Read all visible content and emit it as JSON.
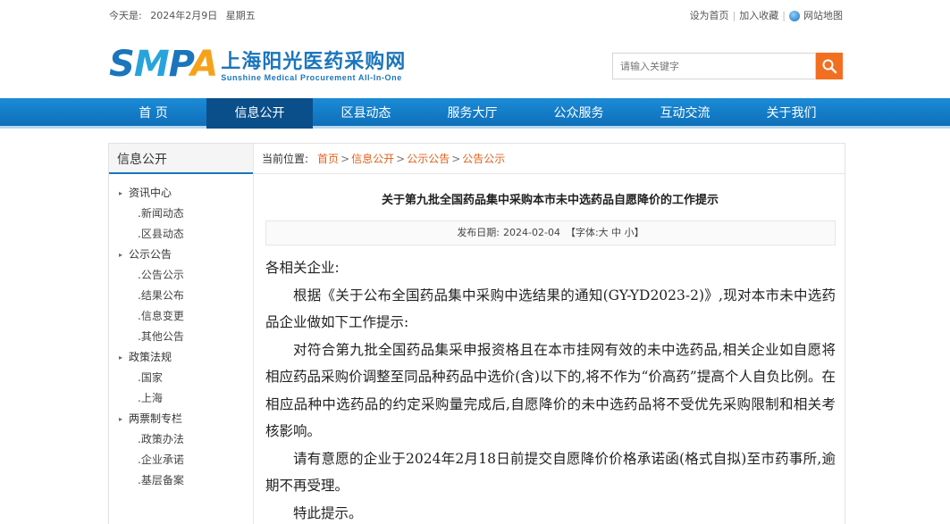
{
  "topbar": {
    "today_label": "今天是:",
    "date": "2024年2月9日",
    "weekday": "星期五",
    "set_home": "设为首页",
    "favorite": "加入收藏",
    "sitemap": "网站地图",
    "separator": "|"
  },
  "header": {
    "logo_mark": {
      "s": "S",
      "m": "M",
      "p": "P",
      "a": "A"
    },
    "logo_cn": "上海阳光医药采购网",
    "logo_en": "Sunshine Medical Procurement All-In-One",
    "search_placeholder": "请输入关键字"
  },
  "nav": {
    "items": [
      {
        "label": "首 页"
      },
      {
        "label": "信息公开"
      },
      {
        "label": "区县动态"
      },
      {
        "label": "服务大厅"
      },
      {
        "label": "公众服务"
      },
      {
        "label": "互动交流"
      },
      {
        "label": "关于我们"
      }
    ],
    "active_index": 1
  },
  "sidebar": {
    "title": "信息公开",
    "groups": [
      {
        "label": "资讯中心",
        "items": [
          ".新闻动态",
          ".区县动态"
        ]
      },
      {
        "label": "公示公告",
        "items": [
          ".公告公示",
          ".结果公布",
          ".信息变更",
          ".其他公告"
        ]
      },
      {
        "label": "政策法规",
        "items": [
          ".国家",
          ".上海"
        ]
      },
      {
        "label": "两票制专栏",
        "items": [
          ".政策办法",
          ".企业承诺",
          ".基层备案"
        ]
      }
    ]
  },
  "breadcrumb": {
    "label": "当前位置:",
    "items": [
      "首页",
      "信息公开",
      "公示公告",
      "公告公示"
    ],
    "separator": ">"
  },
  "article": {
    "title": "关于第九批全国药品集中采购本市未中选药品自愿降价的工作提示",
    "date_label": "发布日期:",
    "date": "2024-02-04",
    "font_size_label": "【字体:大 中 小】",
    "salutation": "各相关企业:",
    "paragraphs": [
      "根据《关于公布全国药品集中采购中选结果的通知(GY-YD2023-2)》,现对本市未中选药品企业做如下工作提示:",
      "对符合第九批全国药品集采申报资格且在本市挂网有效的未中选药品,相关企业如自愿将相应药品采购价调整至同品种药品中选价(含)以下的,将不作为“价高药”提高个人自负比例。在相应品种中选药品的约定采购量完成后,自愿降价的未中选药品将不受优先采购限制和相关考核影响。",
      "请有意愿的企业于2024年2月18日前提交自愿降价价格承诺函(格式自拟)至市药事所,逾期不再受理。",
      "特此提示。"
    ]
  },
  "colors": {
    "nav_bg": "#1b8bd6",
    "nav_active": "#0a4f8a",
    "brand_blue": "#1b75bc",
    "accent_orange": "#f26f21",
    "crumb_link": "#e0631f"
  },
  "icons": {
    "globe": "globe-icon",
    "search": "search-icon",
    "arrow": "arrow-right-icon"
  }
}
